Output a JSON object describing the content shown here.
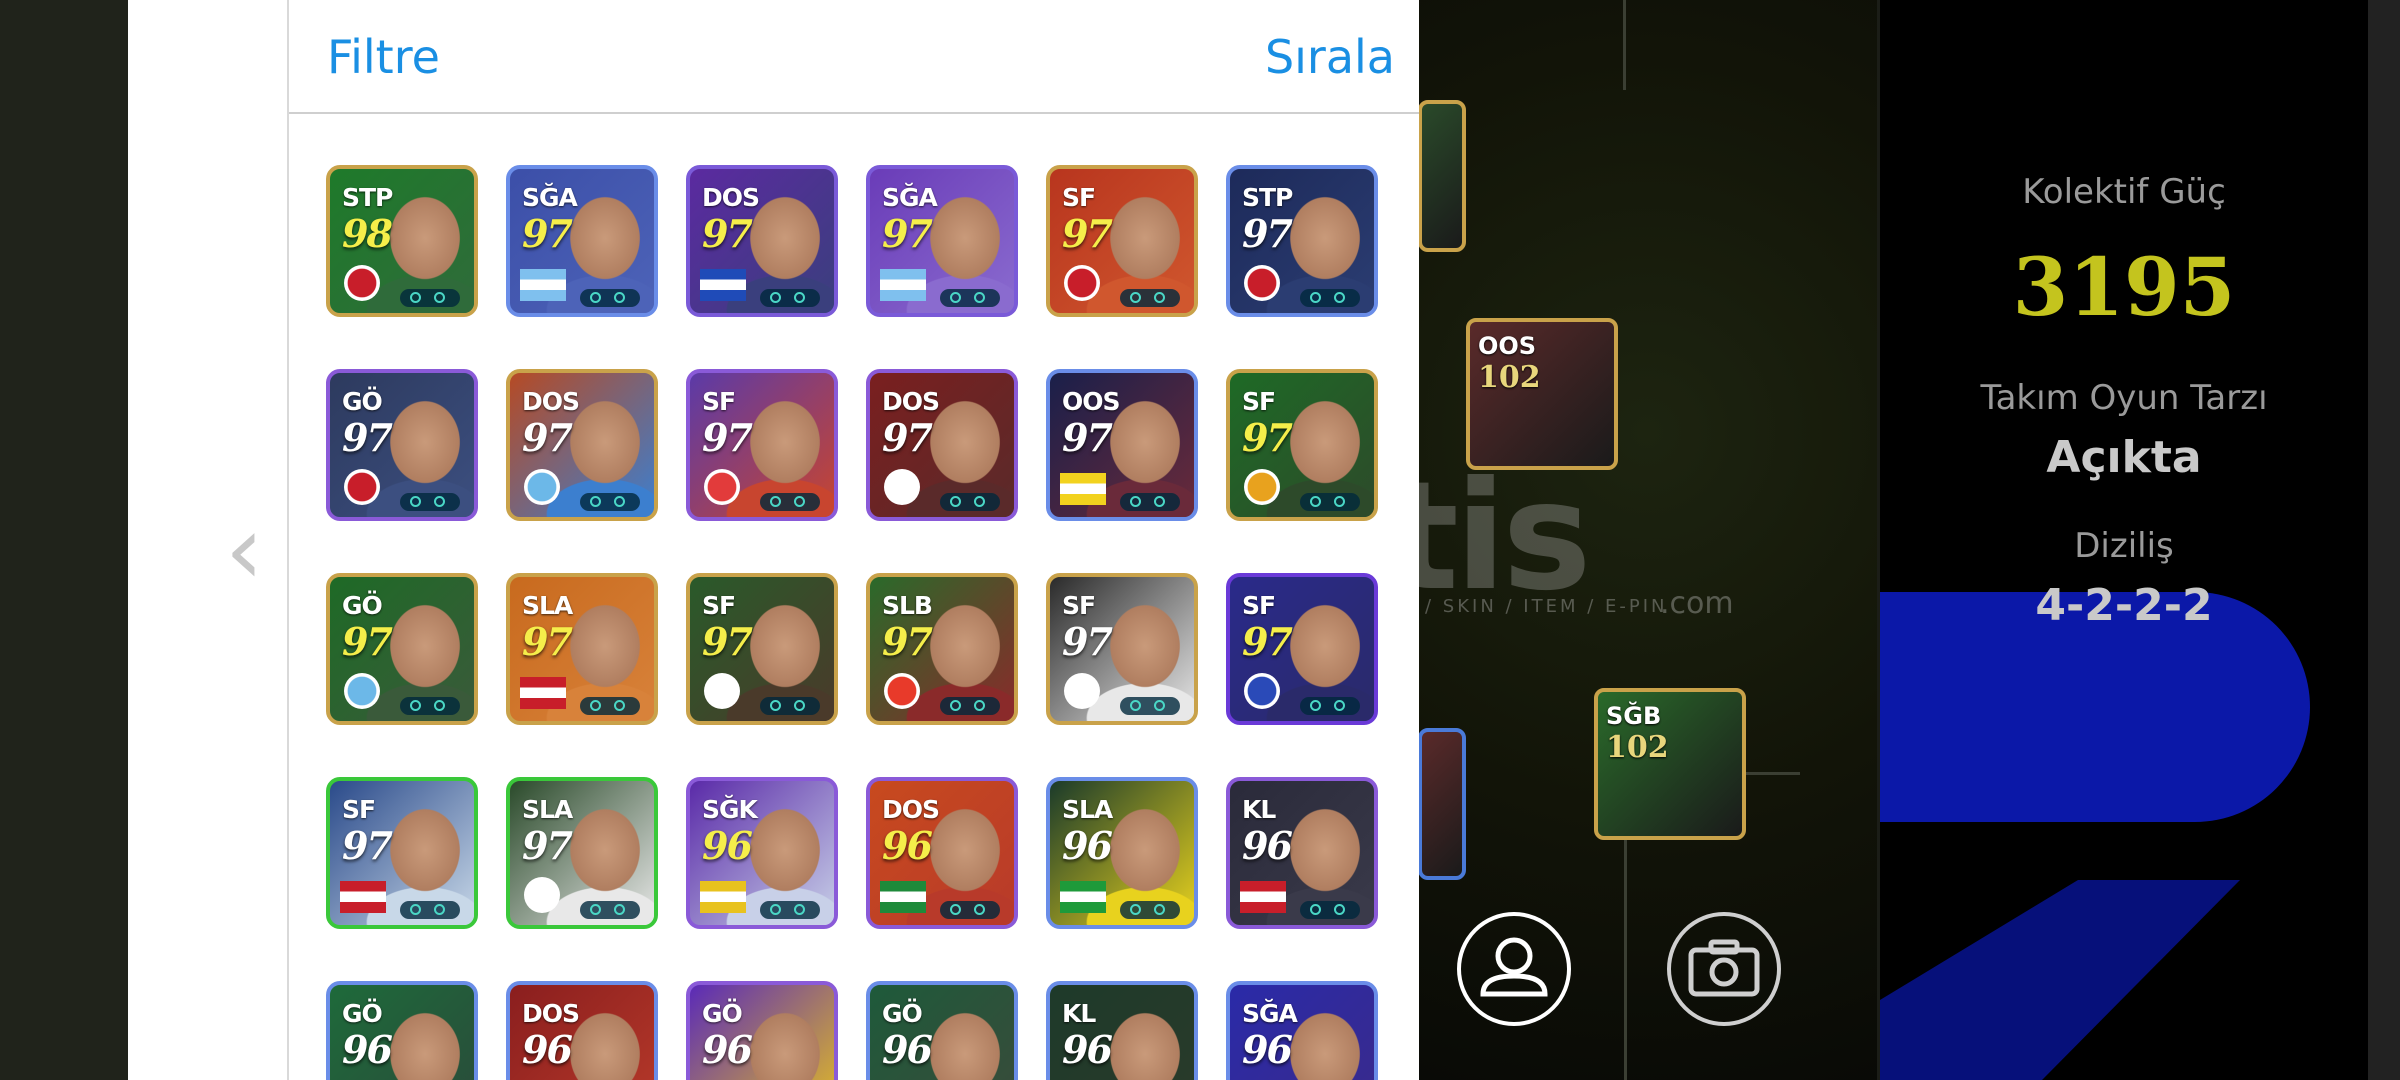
{
  "panel": {
    "filter_label": "Filtre",
    "sort_label": "Sırala"
  },
  "players": [
    {
      "pos": "STP",
      "rating": "98",
      "gold": true,
      "bg": "#1e7a2a",
      "border": "#c9a24a",
      "photo": "#2f6b3a",
      "mark": "badge",
      "mark_color": "#c81e2a"
    },
    {
      "pos": "SĞA",
      "rating": "97",
      "gold": true,
      "bg": "#3c4fa8",
      "border": "#6a8de8",
      "photo": "#4d63b8",
      "mark": "flag",
      "mark_color": "#7fc0ee"
    },
    {
      "pos": "DOS",
      "rating": "97",
      "gold": true,
      "bg": "#5b2aa0",
      "border": "#7a5ad8",
      "photo": "#3a3f7d",
      "mark": "flag",
      "mark_color": "#1f4bb8"
    },
    {
      "pos": "SĞA",
      "rating": "97",
      "gold": true,
      "bg": "#6a3cb8",
      "border": "#7a5ad8",
      "photo": "#8a6bcf",
      "mark": "flag",
      "mark_color": "#7fc0ee"
    },
    {
      "pos": "SF",
      "rating": "97",
      "gold": true,
      "bg": "#b8351e",
      "border": "#c9a24a",
      "photo": "#d0572e",
      "mark": "badge",
      "mark_color": "#c81e2a"
    },
    {
      "pos": "STP",
      "rating": "97",
      "gold": false,
      "bg": "#1d2a5a",
      "border": "#6a8de8",
      "photo": "#2b3d72",
      "mark": "badge",
      "mark_color": "#c81e2a"
    },
    {
      "pos": "GÖ",
      "rating": "97",
      "gold": false,
      "bg": "#2d3a5e",
      "border": "#8a5ad8",
      "photo": "#3c4f80",
      "mark": "badge",
      "mark_color": "#c81e2a"
    },
    {
      "pos": "DOS",
      "rating": "97",
      "gold": false,
      "bg": "#b64a24",
      "border": "#c9a24a",
      "photo": "#3c7fcf",
      "mark": "badge",
      "mark_color": "#6cb8e8"
    },
    {
      "pos": "SF",
      "rating": "97",
      "gold": false,
      "bg": "#5b3aa8",
      "border": "#8a5ad8",
      "photo": "#c8452f",
      "mark": "badge",
      "mark_color": "#e23b3b"
    },
    {
      "pos": "DOS",
      "rating": "97",
      "gold": false,
      "bg": "#7a1f1f",
      "border": "#8a5ad8",
      "photo": "#5a2a2a",
      "mark": "badge",
      "mark_color": "#ffffff"
    },
    {
      "pos": "OOS",
      "rating": "97",
      "gold": false,
      "bg": "#1a1f4a",
      "border": "#6a8de8",
      "photo": "#6a2a3a",
      "mark": "flag",
      "mark_color": "#f2d21e"
    },
    {
      "pos": "SF",
      "rating": "97",
      "gold": true,
      "bg": "#1e6a26",
      "border": "#c9a24a",
      "photo": "#2d4a2a",
      "mark": "badge",
      "mark_color": "#e8a21e"
    },
    {
      "pos": "GÖ",
      "rating": "97",
      "gold": true,
      "bg": "#1e6a26",
      "border": "#c9a24a",
      "photo": "#3a5a3a",
      "mark": "badge",
      "mark_color": "#6cb8e8"
    },
    {
      "pos": "SLA",
      "rating": "97",
      "gold": true,
      "bg": "#c86a1e",
      "border": "#c9a24a",
      "photo": "#d8823a",
      "mark": "flag",
      "mark_color": "#c81e2a"
    },
    {
      "pos": "SF",
      "rating": "97",
      "gold": true,
      "bg": "#2a5a2a",
      "border": "#c9a24a",
      "photo": "#4a3a2a",
      "mark": "badge",
      "mark_color": "#ffffff"
    },
    {
      "pos": "SLB",
      "rating": "97",
      "gold": true,
      "bg": "#2a6a2a",
      "border": "#c9a24a",
      "photo": "#8a2a2a",
      "mark": "badge",
      "mark_color": "#e83a2a"
    },
    {
      "pos": "SF",
      "rating": "97",
      "gold": false,
      "bg": "#2a2a2a",
      "border": "#c9a24a",
      "photo": "#e8e8e8",
      "mark": "badge",
      "mark_color": "#ffffff"
    },
    {
      "pos": "SF",
      "rating": "97",
      "gold": true,
      "bg": "#2a2a8a",
      "border": "#6a3ad8",
      "photo": "#2a2a6a",
      "mark": "badge",
      "mark_color": "#2a4ab8"
    },
    {
      "pos": "SF",
      "rating": "97",
      "gold": false,
      "bg": "#2a4a8a",
      "border": "#3ac83a",
      "photo": "#c8d8e8",
      "mark": "flag",
      "mark_color": "#c81e2a"
    },
    {
      "pos": "SLA",
      "rating": "97",
      "gold": false,
      "bg": "#2a4a2a",
      "border": "#3ac83a",
      "photo": "#e8e8e8",
      "mark": "badge",
      "mark_color": "#ffffff"
    },
    {
      "pos": "SĞK",
      "rating": "96",
      "gold": true,
      "bg": "#5a2aa8",
      "border": "#8a5ad8",
      "photo": "#c8d0e8",
      "mark": "flag",
      "mark_color": "#e8c21e"
    },
    {
      "pos": "DOS",
      "rating": "96",
      "gold": true,
      "bg": "#c84a1e",
      "border": "#8a5ad8",
      "photo": "#b83a2a",
      "mark": "flag",
      "mark_color": "#1e8a3a"
    },
    {
      "pos": "SLA",
      "rating": "96",
      "gold": false,
      "bg": "#1a3a2a",
      "border": "#6a8de8",
      "photo": "#e8d21e",
      "mark": "flag",
      "mark_color": "#1e9a3a"
    },
    {
      "pos": "KL",
      "rating": "96",
      "gold": false,
      "bg": "#2a2a3a",
      "border": "#8a5ad8",
      "photo": "#3a3a4a",
      "mark": "flag",
      "mark_color": "#c81e2a"
    },
    {
      "pos": "GÖ",
      "rating": "96",
      "gold": false,
      "bg": "#1e6a3a",
      "border": "#6a8de8",
      "photo": "#2a4a3a",
      "mark": "badge",
      "mark_color": "#ffffff"
    },
    {
      "pos": "DOS",
      "rating": "96",
      "gold": false,
      "bg": "#8a1e1e",
      "border": "#6a8de8",
      "photo": "#b83a2a",
      "mark": "badge",
      "mark_color": "#ffffff"
    },
    {
      "pos": "GÖ",
      "rating": "96",
      "gold": false,
      "bg": "#5a2ab8",
      "border": "#8a5ad8",
      "photo": "#e8c21e",
      "mark": "badge",
      "mark_color": "#ffffff"
    },
    {
      "pos": "GÖ",
      "rating": "96",
      "gold": false,
      "bg": "#1e5a3a",
      "border": "#6a8de8",
      "photo": "#3a4a3a",
      "mark": "badge",
      "mark_color": "#ffffff"
    },
    {
      "pos": "KL",
      "rating": "96",
      "gold": false,
      "bg": "#1e3a2a",
      "border": "#6a8de8",
      "photo": "#2a3a2a",
      "mark": "badge",
      "mark_color": "#ffffff"
    },
    {
      "pos": "SĞA",
      "rating": "96",
      "gold": false,
      "bg": "#2a2aa8",
      "border": "#6a8de8",
      "photo": "#3a2a8a",
      "mark": "badge",
      "mark_color": "#ffffff"
    }
  ],
  "formation_cards": [
    {
      "pos": "",
      "rating": "",
      "bg": "#2a4a2a",
      "border": "#c9a24a"
    },
    {
      "pos": "OOS",
      "rating": "102",
      "bg": "#5a2a2a",
      "border": "#c9a24a"
    },
    {
      "pos": "",
      "rating": "",
      "bg": "#5a2a2a",
      "border": "#4a7ad8"
    },
    {
      "pos": "SĞB",
      "rating": "102",
      "bg": "#2a6a2a",
      "border": "#c9a24a"
    }
  ],
  "watermark": {
    "text": "atis",
    "sub": "/ SKIN / ITEM / E-PIN",
    "com": ".com"
  },
  "stats": {
    "collective_label": "Kolektif Güç",
    "collective_value": "3195",
    "style_label": "Takım Oyun Tarzı",
    "style_value": "Açıkta",
    "formation_label": "Diziliş",
    "formation_value": "4-2-2-2"
  },
  "icons": {
    "back": "‹",
    "profile": "person-icon",
    "camera": "camera-icon"
  }
}
